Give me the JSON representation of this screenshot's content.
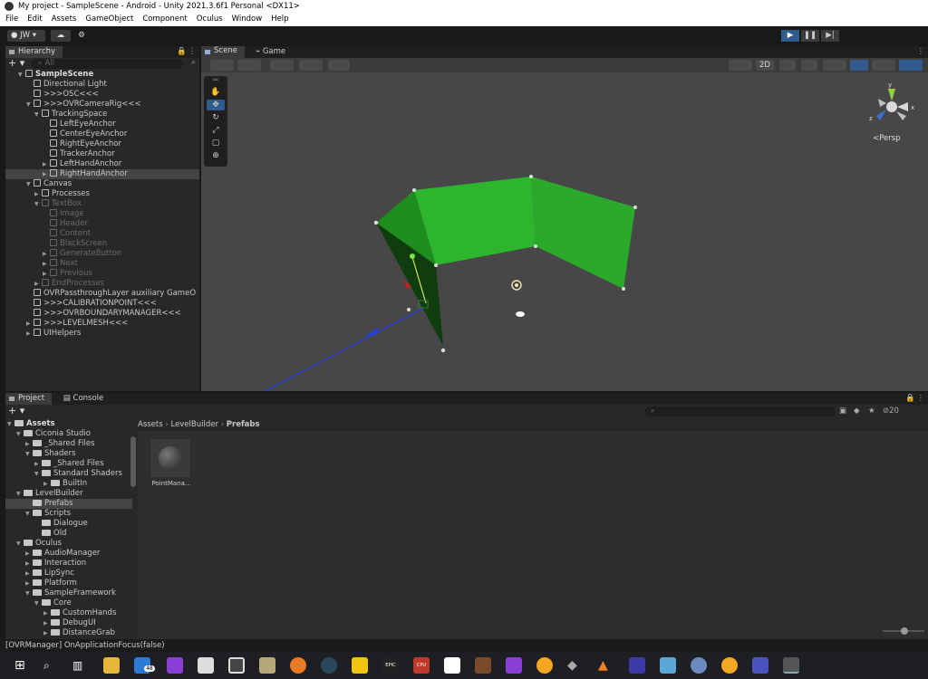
{
  "window": {
    "title": "My project - SampleScene - Android - Unity 2021.3.6f1 Personal <DX11>"
  },
  "menu": [
    "File",
    "Edit",
    "Assets",
    "GameObject",
    "Component",
    "Oculus",
    "Window",
    "Help"
  ],
  "toolbar": {
    "account": "JW"
  },
  "hierarchy": {
    "tab": "Hierarchy",
    "search_placeholder": "All",
    "rows": [
      {
        "label": "SampleScene",
        "depth": 0,
        "expanded": true,
        "kind": "scene"
      },
      {
        "label": "Directional Light",
        "depth": 1,
        "kind": "object"
      },
      {
        "label": ">>>OSC<<<",
        "depth": 1,
        "kind": "object"
      },
      {
        "label": ">>>OVRCameraRig<<<",
        "depth": 1,
        "expanded": true,
        "kind": "object"
      },
      {
        "label": "TrackingSpace",
        "depth": 2,
        "expanded": true,
        "kind": "object"
      },
      {
        "label": "LeftEyeAnchor",
        "depth": 3,
        "kind": "object"
      },
      {
        "label": "CenterEyeAnchor",
        "depth": 3,
        "kind": "object"
      },
      {
        "label": "RightEyeAnchor",
        "depth": 3,
        "kind": "object"
      },
      {
        "label": "TrackerAnchor",
        "depth": 3,
        "kind": "object"
      },
      {
        "label": "LeftHandAnchor",
        "depth": 3,
        "collapsed": true,
        "kind": "object"
      },
      {
        "label": "RightHandAnchor",
        "depth": 3,
        "collapsed": true,
        "selected": true,
        "kind": "object"
      },
      {
        "label": "Canvas",
        "depth": 1,
        "expanded": true,
        "kind": "object"
      },
      {
        "label": "Processes",
        "depth": 2,
        "collapsed": true,
        "kind": "object"
      },
      {
        "label": "TextBox",
        "depth": 2,
        "expanded": true,
        "dim": true,
        "kind": "object"
      },
      {
        "label": "Image",
        "depth": 3,
        "dim": true,
        "kind": "object"
      },
      {
        "label": "Header",
        "depth": 3,
        "dim": true,
        "kind": "object"
      },
      {
        "label": "Content",
        "depth": 3,
        "dim": true,
        "kind": "object"
      },
      {
        "label": "BlackScreen",
        "depth": 3,
        "dim": true,
        "kind": "object"
      },
      {
        "label": "GenerateButton",
        "depth": 3,
        "collapsed": true,
        "dim": true,
        "kind": "object"
      },
      {
        "label": "Next",
        "depth": 3,
        "collapsed": true,
        "dim": true,
        "kind": "object"
      },
      {
        "label": "Previous",
        "depth": 3,
        "collapsed": true,
        "dim": true,
        "kind": "object"
      },
      {
        "label": "EndProcesses",
        "depth": 2,
        "collapsed": true,
        "dim": true,
        "kind": "object"
      },
      {
        "label": "OVRPassthroughLayer auxiliary GameO",
        "depth": 1,
        "kind": "object"
      },
      {
        "label": ">>>CALIBRATIONPOINT<<<",
        "depth": 1,
        "kind": "object"
      },
      {
        "label": ">>>OVRBOUNDARYMANAGER<<<",
        "depth": 1,
        "kind": "object"
      },
      {
        "label": ">>>LEVELMESH<<<",
        "depth": 1,
        "collapsed": true,
        "kind": "object"
      },
      {
        "label": "UIHelpers",
        "depth": 1,
        "collapsed": true,
        "kind": "object"
      }
    ]
  },
  "scene": {
    "tabs": [
      "Scene",
      "Game"
    ],
    "mode2d": "2D",
    "persp": "<Persp",
    "axes": {
      "x": "x",
      "y": "y",
      "z": "z"
    }
  },
  "project": {
    "tabs": [
      "Project",
      "Console"
    ],
    "hidden_count": "20",
    "breadcrumb": [
      "Assets",
      "LevelBuilder",
      "Prefabs"
    ],
    "tree": [
      {
        "label": "Assets",
        "depth": 0,
        "expanded": true
      },
      {
        "label": "Ciconia Studio",
        "depth": 1,
        "expanded": true
      },
      {
        "label": "_Shared Files",
        "depth": 2,
        "collapsed": true
      },
      {
        "label": "Shaders",
        "depth": 2,
        "expanded": true
      },
      {
        "label": "_Shared Files",
        "depth": 3,
        "collapsed": true
      },
      {
        "label": "Standard Shaders",
        "depth": 3,
        "expanded": true
      },
      {
        "label": "BuiltIn",
        "depth": 4,
        "collapsed": true
      },
      {
        "label": "LevelBuilder",
        "depth": 1,
        "expanded": true
      },
      {
        "label": "Prefabs",
        "depth": 2,
        "selected": true
      },
      {
        "label": "Scripts",
        "depth": 2,
        "expanded": true
      },
      {
        "label": "Dialogue",
        "depth": 3
      },
      {
        "label": "Old",
        "depth": 3
      },
      {
        "label": "Oculus",
        "depth": 1,
        "expanded": true
      },
      {
        "label": "AudioManager",
        "depth": 2,
        "collapsed": true
      },
      {
        "label": "Interaction",
        "depth": 2,
        "collapsed": true
      },
      {
        "label": "LipSync",
        "depth": 2,
        "collapsed": true
      },
      {
        "label": "Platform",
        "depth": 2,
        "collapsed": true
      },
      {
        "label": "SampleFramework",
        "depth": 2,
        "expanded": true
      },
      {
        "label": "Core",
        "depth": 3,
        "expanded": true
      },
      {
        "label": "CustomHands",
        "depth": 4,
        "collapsed": true
      },
      {
        "label": "DebugUI",
        "depth": 4,
        "collapsed": true
      },
      {
        "label": "DistanceGrab",
        "depth": 4,
        "collapsed": true
      }
    ],
    "assets": [
      {
        "label": "PointMana..."
      }
    ]
  },
  "status": {
    "message": "[OVRManager] OnApplicationFocus(false)"
  },
  "taskbar": {
    "mail_badge": "48",
    "epic": "EPIC",
    "cpu": "CPU"
  },
  "colors": {
    "accent": "#2f5c8d",
    "plane": "#2db52d"
  }
}
